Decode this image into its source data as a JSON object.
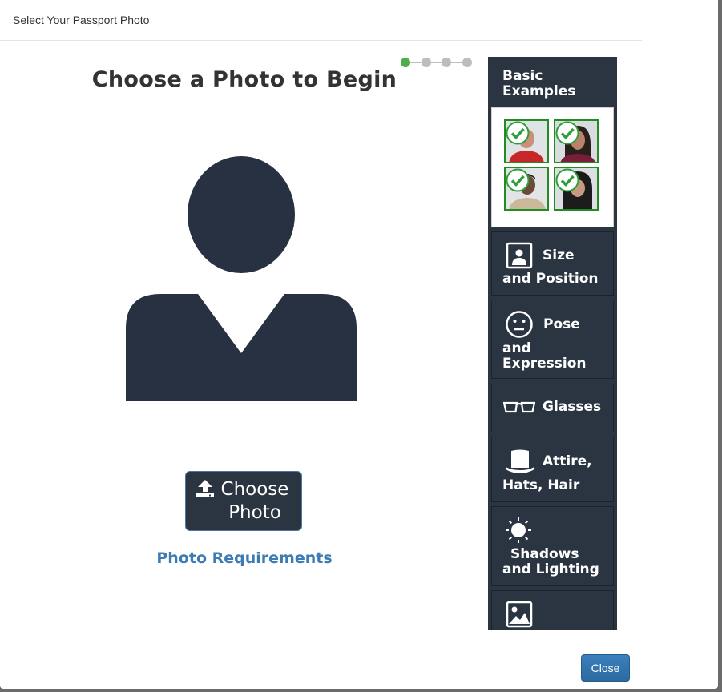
{
  "modal": {
    "title": "Select Your Passport Photo"
  },
  "steps": {
    "total": 4,
    "current": 1
  },
  "main": {
    "heading": "Choose a Photo to Begin",
    "choose_button": "Choose Photo",
    "requirements_link": "Photo Requirements"
  },
  "sidebar": {
    "examples_title": "Basic Examples",
    "items": [
      {
        "icon": "portrait-frame-icon",
        "line1": "Size",
        "line2": "and Position"
      },
      {
        "icon": "neutral-face-icon",
        "line1": "Pose",
        "line2": "and",
        "line3": "Expression"
      },
      {
        "icon": "glasses-icon",
        "line1": "Glasses"
      },
      {
        "icon": "top-hat-icon",
        "line1": "Attire,",
        "line2": "Hats, Hair"
      },
      {
        "icon": "sun-icon",
        "line1": "Shadows",
        "line2": "and Lighting"
      },
      {
        "icon": "image-icon"
      }
    ]
  },
  "footer": {
    "close_button": "Close"
  },
  "colors": {
    "accent": "#2b3542",
    "link": "#3c7bb4",
    "primary_button": "#2e6da4",
    "step_active": "#4cae4c",
    "step_inactive": "#bdbdbd",
    "check_green": "#228b22"
  }
}
